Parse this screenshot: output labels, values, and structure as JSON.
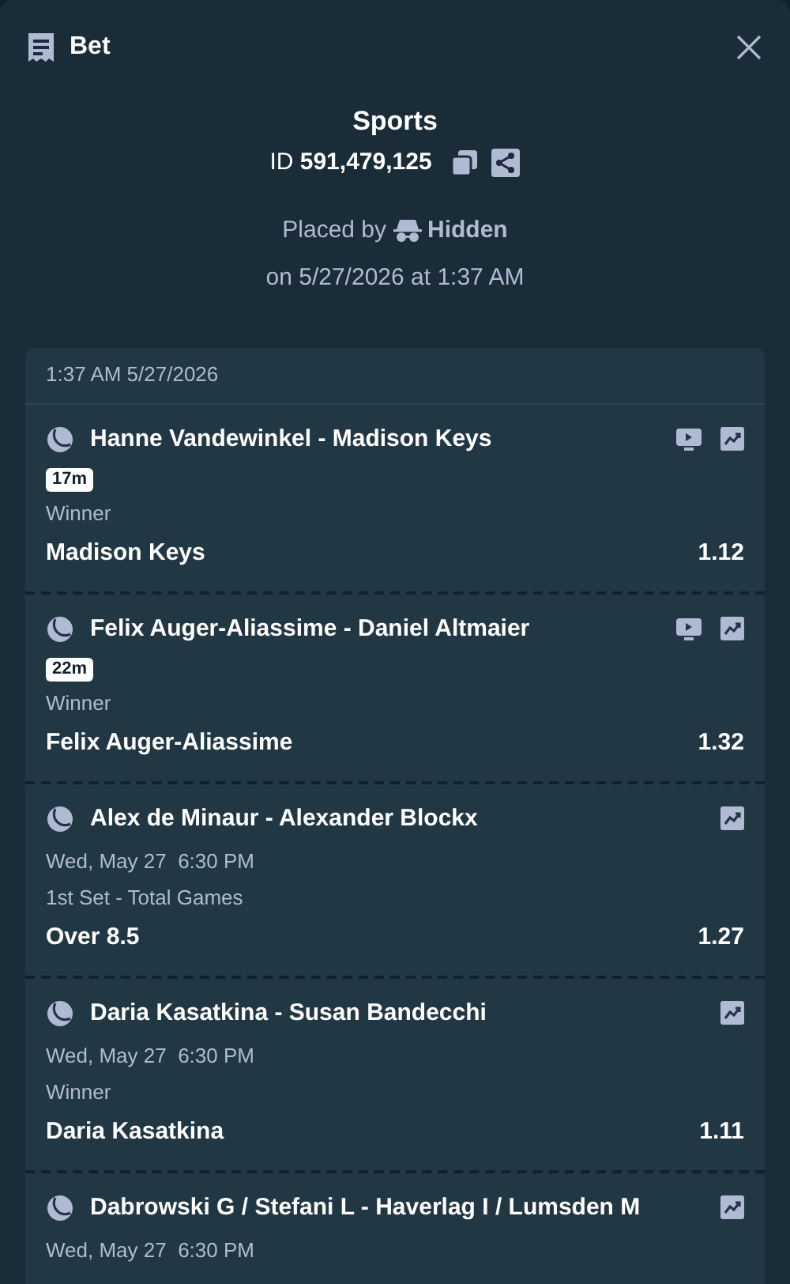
{
  "header": {
    "title": "Bet"
  },
  "summary": {
    "title": "Sports",
    "id_label": "ID",
    "id_value": "591,479,125",
    "placed_by_label": "Placed by",
    "placed_by": "Hidden",
    "placed_on": "on 5/27/2026 at 1:37 AM"
  },
  "slip": {
    "timestamp": "1:37 AM 5/27/2026",
    "legs": [
      {
        "kind": "live",
        "event": "Hanne Vandewinkel - Madison Keys",
        "badge": "17m",
        "market": "Winner",
        "selection": "Madison Keys",
        "odds": "1.12"
      },
      {
        "kind": "live",
        "event": "Felix Auger-Aliassime - Daniel Altmaier",
        "badge": "22m",
        "market": "Winner",
        "selection": "Felix Auger-Aliassime",
        "odds": "1.32"
      },
      {
        "kind": "upcoming",
        "event": "Alex de Minaur - Alexander Blockx",
        "start": "Wed, May 27  6:30 PM",
        "market": "1st Set - Total Games",
        "selection": "Over 8.5",
        "odds": "1.27"
      },
      {
        "kind": "upcoming",
        "event": "Daria Kasatkina - Susan Bandecchi",
        "start": "Wed, May 27  6:30 PM",
        "market": "Winner",
        "selection": "Daria Kasatkina",
        "odds": "1.11"
      },
      {
        "kind": "upcoming",
        "event": "Dabrowski G / Stefani L - Haverlag I / Lumsden M",
        "start": "Wed, May 27  6:30 PM"
      }
    ]
  }
}
